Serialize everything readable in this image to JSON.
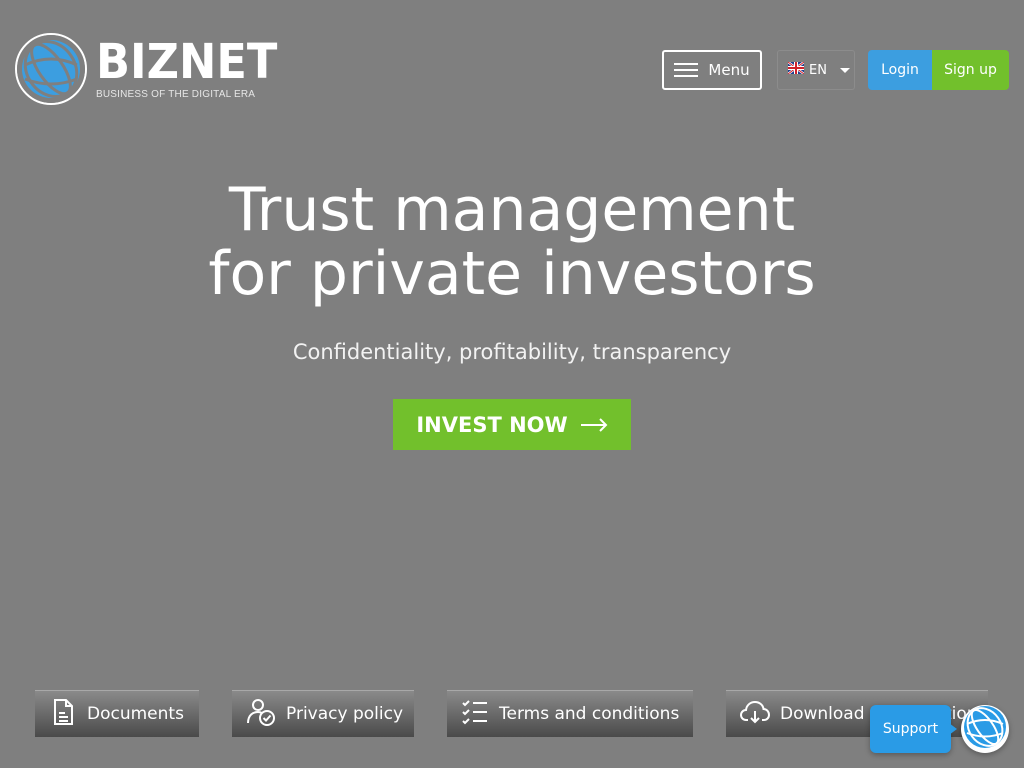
{
  "header": {
    "brand": "BIZNET",
    "tagline": "BUSINESS OF THE DIGITAL ERA",
    "menu_label": "Menu",
    "language": "EN",
    "login_label": "Login",
    "signup_label": "Sign up"
  },
  "hero": {
    "title_line1": "Trust management",
    "title_line2": "for private investors",
    "subtitle": "Confidentiality, profitability, transparency",
    "cta_label": "INVEST NOW"
  },
  "footer_links": {
    "documents": "Documents",
    "privacy": "Privacy policy",
    "terms": "Terms and conditions",
    "download": "Download presentation"
  },
  "support": {
    "label": "Support"
  },
  "colors": {
    "background": "#7f7f7f",
    "login_blue": "#3c9ee0",
    "accent_green": "#72c02c",
    "support_blue": "#2a9be6"
  },
  "icons": {
    "logo": "globe-icon",
    "menu": "hamburger-icon",
    "language_flag": "uk-flag-icon",
    "cta": "arrow-right-icon",
    "documents": "document-icon",
    "privacy": "user-check-icon",
    "terms": "checklist-icon",
    "download": "cloud-download-icon",
    "support_avatar": "globe-icon"
  }
}
